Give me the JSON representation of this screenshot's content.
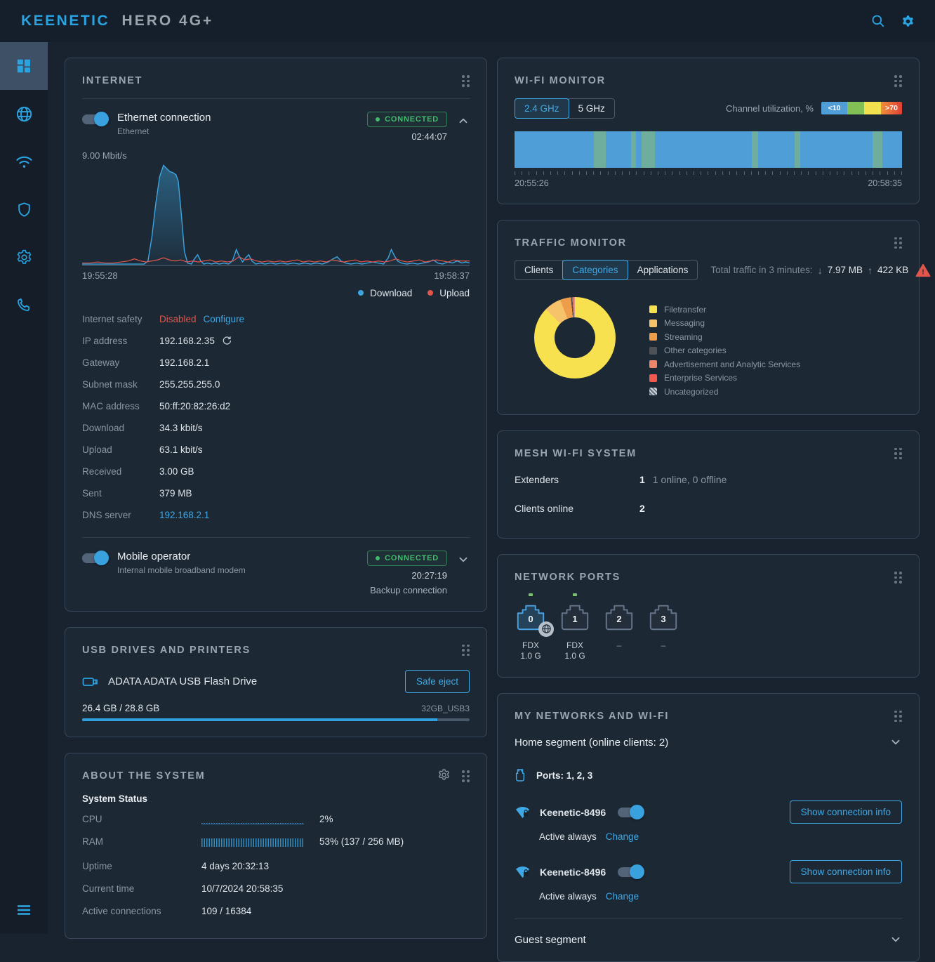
{
  "topbar": {
    "brand_primary": "KEENETIC",
    "brand_secondary": "HERO 4G+"
  },
  "sidebar": {
    "items": [
      "dashboard",
      "internet",
      "wireless",
      "security",
      "management",
      "support",
      "menu"
    ]
  },
  "internet": {
    "title": "INTERNET",
    "ethernet": {
      "name": "Ethernet connection",
      "subtitle": "Ethernet",
      "status": "CONNECTED",
      "uptime": "02:44:07"
    },
    "details": [
      {
        "label": "Internet safety",
        "value": "Disabled",
        "color": "danger",
        "extra": "Configure"
      },
      {
        "label": "IP address",
        "value": "192.168.2.35",
        "refresh": true
      },
      {
        "label": "Gateway",
        "value": "192.168.2.1"
      },
      {
        "label": "Subnet mask",
        "value": "255.255.255.0"
      },
      {
        "label": "MAC address",
        "value": "50:ff:20:82:26:d2"
      },
      {
        "label": "Download",
        "value": "34.3 kbit/s"
      },
      {
        "label": "Upload",
        "value": "63.1 kbit/s"
      },
      {
        "label": "Received",
        "value": "3.00 GB"
      },
      {
        "label": "Sent",
        "value": "379 MB"
      },
      {
        "label": "DNS server",
        "value": "192.168.2.1",
        "color": "link"
      }
    ],
    "mobile": {
      "name": "Mobile operator",
      "subtitle": "Internal mobile broadband modem",
      "status": "CONNECTED",
      "uptime": "20:27:19",
      "note": "Backup connection"
    }
  },
  "usb": {
    "title": "USB DRIVES AND PRINTERS",
    "device_name": "ADATA ADATA USB Flash Drive",
    "eject_label": "Safe eject",
    "used_label": "26.4 GB / 28.8 GB",
    "volume_label": "32GB_USB3"
  },
  "about": {
    "title": "ABOUT THE SYSTEM",
    "section_title": "System Status",
    "cpu_label": "CPU",
    "cpu_value": "2%",
    "ram_label": "RAM",
    "ram_value": "53% (137 / 256 MB)",
    "rows": [
      {
        "label": "Uptime",
        "value": "4 days 20:32:13"
      },
      {
        "label": "Current time",
        "value": "10/7/2024 20:58:35"
      },
      {
        "label": "Active connections",
        "value": "109 / 16384"
      }
    ]
  },
  "wifi_monitor": {
    "title": "WI-FI MONITOR",
    "tabs": [
      "2.4 GHz",
      "5 GHz"
    ],
    "active_tab": "2.4 GHz",
    "channel_label": "Channel utilization, %",
    "legend_low": "<10",
    "legend_high": ">70",
    "legend_colors": [
      "#4f9ed7",
      "#82bf54",
      "#f2e04e",
      "#e8623d"
    ]
  },
  "traffic_monitor": {
    "title": "TRAFFIC MONITOR",
    "tabs": [
      "Clients",
      "Categories",
      "Applications"
    ],
    "active_tab": "Categories",
    "total_label": "Total traffic in 3 minutes:",
    "down": "7.97 MB",
    "up": "422 KB"
  },
  "mesh": {
    "title": "MESH WI-FI SYSTEM",
    "rows": [
      {
        "label": "Extenders",
        "value": "1",
        "note": "1 online, 0 offline"
      },
      {
        "label": "Clients online",
        "value": "2",
        "note": ""
      }
    ]
  },
  "ports": {
    "title": "NETWORK PORTS",
    "items": [
      {
        "number": "0",
        "led": true,
        "active": true,
        "wan": true,
        "status_lines": [
          "FDX",
          "1.0 G"
        ]
      },
      {
        "number": "1",
        "led": true,
        "active": false,
        "wan": false,
        "status_lines": [
          "FDX",
          "1.0 G"
        ]
      },
      {
        "number": "2",
        "led": false,
        "active": false,
        "wan": false,
        "status_lines": [
          "–"
        ]
      },
      {
        "number": "3",
        "led": false,
        "active": false,
        "wan": false,
        "status_lines": [
          "–"
        ]
      }
    ]
  },
  "networks": {
    "title": "MY NETWORKS AND WI-FI",
    "segments": [
      {
        "name": "Home segment (online clients: 2)",
        "expanded": true,
        "ports_label": "Ports: 1, 2, 3",
        "wifi": [
          {
            "ssid": "Keenetic-8496",
            "enabled": true,
            "schedule": "Active always",
            "change_label": "Change",
            "button": "Show connection info"
          },
          {
            "ssid": "Keenetic-8496",
            "enabled": true,
            "schedule": "Active always",
            "change_label": "Change",
            "button": "Show connection info"
          }
        ]
      },
      {
        "name": "Guest segment",
        "expanded": false,
        "ports_label": "",
        "wifi": []
      }
    ]
  },
  "chart_data": [
    {
      "id": "internet-traffic",
      "type": "line",
      "ylabel": "9.00 Mbit/s",
      "ymax_mbit": 9,
      "x_start": "19:55:28",
      "x_end": "19:58:37",
      "legend": [
        {
          "name": "Download",
          "color": "#3da5e0"
        },
        {
          "name": "Upload",
          "color": "#e0564c"
        }
      ],
      "series": [
        {
          "name": "Download",
          "color": "#3da5e0",
          "fill": true,
          "points": [
            [
              0,
              2
            ],
            [
              3,
              2
            ],
            [
              6,
              2
            ],
            [
              9,
              2
            ],
            [
              12,
              2
            ],
            [
              14,
              2
            ],
            [
              16,
              2
            ],
            [
              17,
              5
            ],
            [
              18,
              28
            ],
            [
              19,
              60
            ],
            [
              20,
              86
            ],
            [
              21,
              97
            ],
            [
              21.8,
              94
            ],
            [
              22.6,
              91
            ],
            [
              23.4,
              90
            ],
            [
              24.2,
              88
            ],
            [
              24.8,
              82
            ],
            [
              25.6,
              50
            ],
            [
              26.4,
              14
            ],
            [
              27.2,
              3
            ],
            [
              28.2,
              2
            ],
            [
              29,
              7
            ],
            [
              29.8,
              11
            ],
            [
              30.6,
              5
            ],
            [
              31.4,
              2
            ],
            [
              32.4,
              3
            ],
            [
              33.4,
              2
            ],
            [
              34.4,
              3
            ],
            [
              35.4,
              2
            ],
            [
              36.6,
              3
            ],
            [
              37.8,
              2
            ],
            [
              38.8,
              5
            ],
            [
              39.8,
              16
            ],
            [
              40.6,
              9
            ],
            [
              41.4,
              4
            ],
            [
              42.2,
              8
            ],
            [
              43,
              11
            ],
            [
              43.8,
              5
            ],
            [
              44.8,
              2
            ],
            [
              46,
              3
            ],
            [
              47.2,
              2
            ],
            [
              48.6,
              3
            ],
            [
              50,
              2
            ],
            [
              51.5,
              3
            ],
            [
              53,
              2
            ],
            [
              54.5,
              3
            ],
            [
              56,
              2
            ],
            [
              57.5,
              3
            ],
            [
              59,
              2
            ],
            [
              60.5,
              3
            ],
            [
              62,
              2
            ],
            [
              63.5,
              4
            ],
            [
              64.8,
              7
            ],
            [
              65.8,
              9
            ],
            [
              66.8,
              5
            ],
            [
              68,
              3
            ],
            [
              69.4,
              2
            ],
            [
              70.8,
              3
            ],
            [
              72.2,
              2
            ],
            [
              73.6,
              3
            ],
            [
              75,
              4
            ],
            [
              76.4,
              3
            ],
            [
              77.8,
              2
            ],
            [
              79,
              8
            ],
            [
              79.8,
              16
            ],
            [
              80.6,
              10
            ],
            [
              81.4,
              5
            ],
            [
              82.4,
              3
            ],
            [
              83.8,
              2
            ],
            [
              85.2,
              3
            ],
            [
              86.6,
              2
            ],
            [
              88,
              3
            ],
            [
              89.4,
              4
            ],
            [
              90.6,
              6
            ],
            [
              91.8,
              3
            ],
            [
              93,
              2
            ],
            [
              94.4,
              4
            ],
            [
              95.6,
              3
            ],
            [
              96.8,
              5
            ],
            [
              98,
              3
            ],
            [
              99,
              4
            ],
            [
              100,
              3
            ]
          ]
        },
        {
          "name": "Upload",
          "color": "#e0564c",
          "fill": false,
          "points": [
            [
              0,
              3
            ],
            [
              2,
              3
            ],
            [
              4,
              4
            ],
            [
              6,
              3
            ],
            [
              8,
              3
            ],
            [
              10,
              4
            ],
            [
              12,
              5
            ],
            [
              13.5,
              7
            ],
            [
              15,
              5
            ],
            [
              16.5,
              4
            ],
            [
              18,
              5
            ],
            [
              19.5,
              6
            ],
            [
              21,
              8
            ],
            [
              22.5,
              6
            ],
            [
              24,
              5
            ],
            [
              25.5,
              6
            ],
            [
              27,
              4
            ],
            [
              28.5,
              5
            ],
            [
              30,
              4
            ],
            [
              31.5,
              5
            ],
            [
              33,
              6
            ],
            [
              34.5,
              4
            ],
            [
              36,
              5
            ],
            [
              37.5,
              4
            ],
            [
              39,
              5
            ],
            [
              40.5,
              9
            ],
            [
              42,
              6
            ],
            [
              43.5,
              7
            ],
            [
              45,
              5
            ],
            [
              46.5,
              4
            ],
            [
              48,
              5
            ],
            [
              49.5,
              4
            ],
            [
              51,
              5
            ],
            [
              52.5,
              4
            ],
            [
              54,
              5
            ],
            [
              55.5,
              6
            ],
            [
              57,
              4
            ],
            [
              58.5,
              5
            ],
            [
              60,
              4
            ],
            [
              61.5,
              5
            ],
            [
              63,
              4
            ],
            [
              64.5,
              6
            ],
            [
              66,
              5
            ],
            [
              67.5,
              4
            ],
            [
              69,
              5
            ],
            [
              70.5,
              6
            ],
            [
              72,
              4
            ],
            [
              73.5,
              5
            ],
            [
              75,
              4
            ],
            [
              76.5,
              5
            ],
            [
              78,
              4
            ],
            [
              79.5,
              5
            ],
            [
              81,
              7
            ],
            [
              82.5,
              5
            ],
            [
              84,
              4
            ],
            [
              85.5,
              5
            ],
            [
              87,
              6
            ],
            [
              88.5,
              4
            ],
            [
              90,
              5
            ],
            [
              91.5,
              6
            ],
            [
              93,
              5
            ],
            [
              94.5,
              4
            ],
            [
              96,
              6
            ],
            [
              97.5,
              5
            ],
            [
              99,
              5
            ],
            [
              100,
              5
            ]
          ]
        }
      ]
    },
    {
      "id": "wifi-utilization",
      "type": "heatmap",
      "x_start": "20:55:26",
      "x_end": "20:58:35",
      "base_color": "#4f9ed7",
      "stripe_color": "#6fae9c",
      "stripes_pct": [
        [
          20.5,
          3.1
        ],
        [
          30.0,
          1.4
        ],
        [
          32.8,
          3.4
        ],
        [
          61.3,
          1.6
        ],
        [
          72.2,
          1.5
        ],
        [
          92.4,
          2.6
        ]
      ],
      "tick_count": 55
    },
    {
      "id": "traffic-categories",
      "type": "pie",
      "slices": [
        {
          "label": "Filetransfer",
          "color": "#f8e14e",
          "pct": 87.3
        },
        {
          "label": "Messaging",
          "color": "#f6c36a",
          "pct": 6.8
        },
        {
          "label": "Streaming",
          "color": "#ee9e4b",
          "pct": 4.3
        },
        {
          "label": "Other categories",
          "color": "#4e5257",
          "pct": 0.6
        },
        {
          "label": "Advertisement and Analytic Services",
          "color": "#ee8566",
          "pct": 0.4
        },
        {
          "label": "Enterprise Services",
          "color": "#f2594d",
          "pct": 0.4
        },
        {
          "label": "Uncategorized",
          "color": "#cfd5db",
          "pct": 0.2,
          "hatched": true
        }
      ]
    },
    {
      "id": "cpu-usage",
      "type": "bar",
      "value_pct": 2,
      "label": "2%"
    },
    {
      "id": "ram-usage",
      "type": "bar",
      "value_pct": 53,
      "label": "53% (137 / 256 MB)"
    },
    {
      "id": "usb-storage",
      "type": "bar",
      "used_gb": 26.4,
      "total_gb": 28.8,
      "label": "26.4 GB / 28.8 GB"
    }
  ]
}
